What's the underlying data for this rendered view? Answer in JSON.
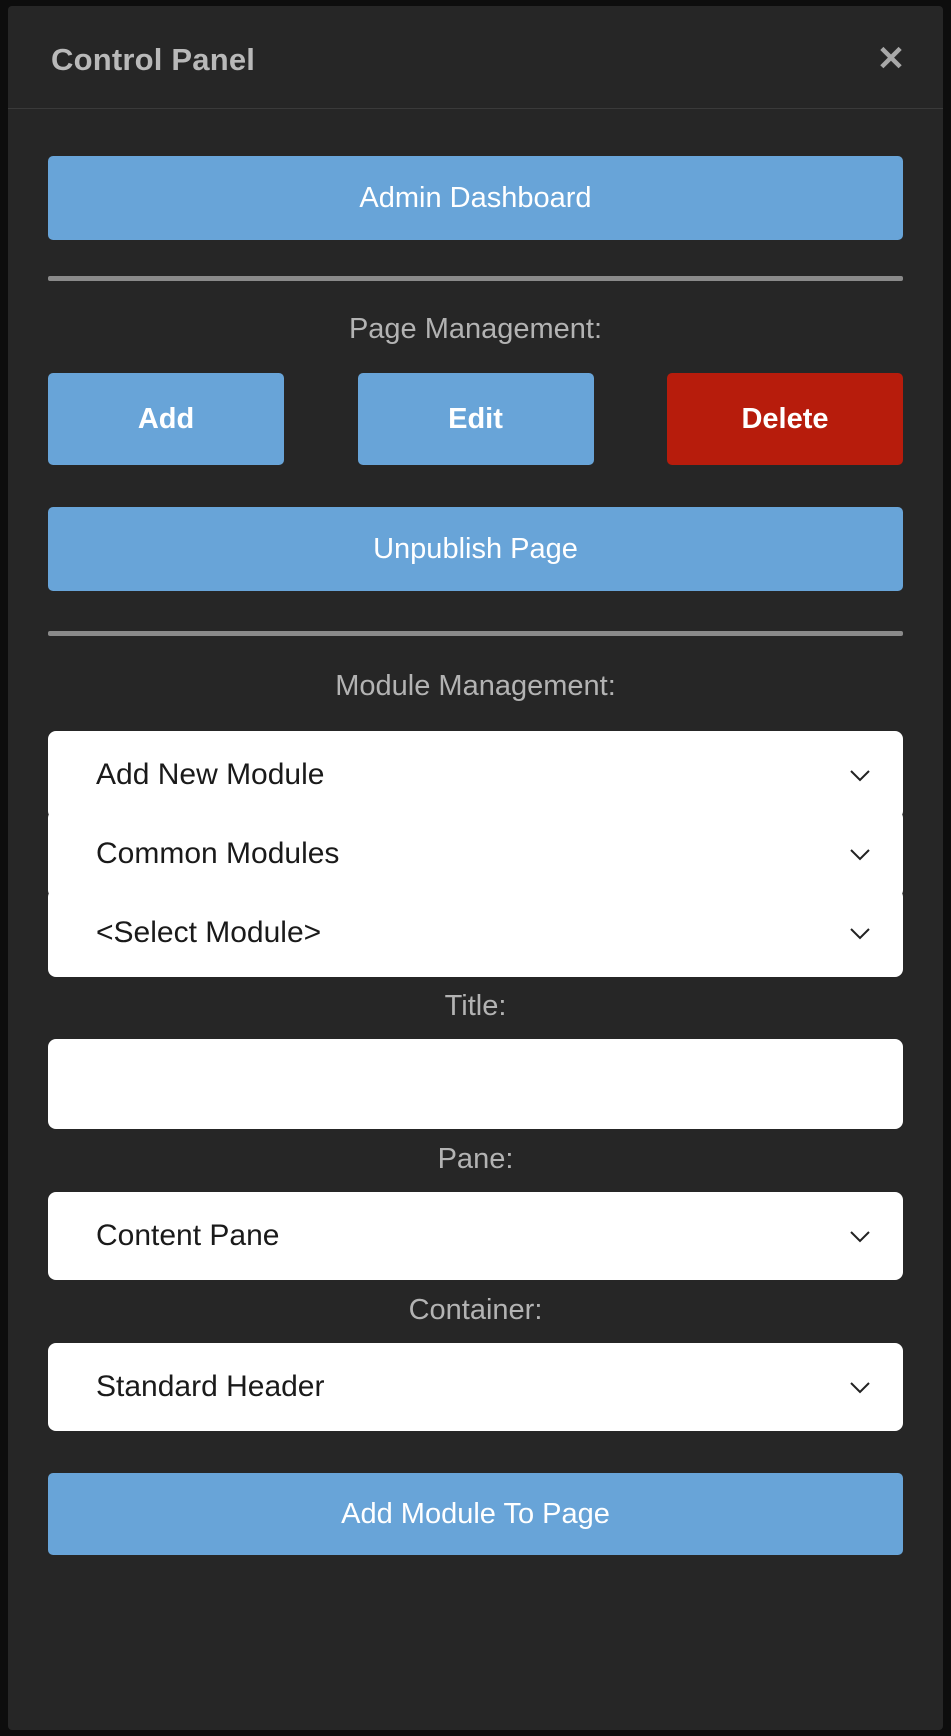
{
  "window": {
    "title": "Control Panel",
    "close_icon": "close-icon",
    "close_glyph": "✕"
  },
  "colors": {
    "panel_bg": "#262626",
    "primary": "#68a4d8",
    "danger": "#b71c0c",
    "label_text": "#b3b3b3",
    "title_text": "#b9b9b9",
    "divider": "#8a8a8a",
    "field_bg": "#ffffff",
    "field_text": "#1a1a1a"
  },
  "admin": {
    "dashboard_label": "Admin Dashboard"
  },
  "page_management": {
    "label": "Page Management:",
    "buttons": [
      {
        "label": "Add",
        "style": "primary"
      },
      {
        "label": "Edit",
        "style": "primary"
      },
      {
        "label": "Delete",
        "style": "danger"
      }
    ],
    "unpublish_label": "Unpublish Page"
  },
  "module_management": {
    "label": "Module Management:",
    "selects": [
      {
        "name": "add-new-module",
        "value": "Add New Module",
        "icon": "chevron-down-icon"
      },
      {
        "name": "common-modules",
        "value": "Common Modules",
        "icon": "chevron-down-icon"
      },
      {
        "name": "select-module",
        "value": "<Select Module>",
        "icon": "chevron-down-icon"
      }
    ],
    "title_field": {
      "label": "Title:",
      "value": "",
      "placeholder": ""
    },
    "pane_field": {
      "label": "Pane:",
      "value": "Content Pane",
      "icon": "chevron-down-icon"
    },
    "container_field": {
      "label": "Container:",
      "value": "Standard Header",
      "icon": "chevron-down-icon"
    },
    "add_module_label": "Add Module To Page"
  }
}
